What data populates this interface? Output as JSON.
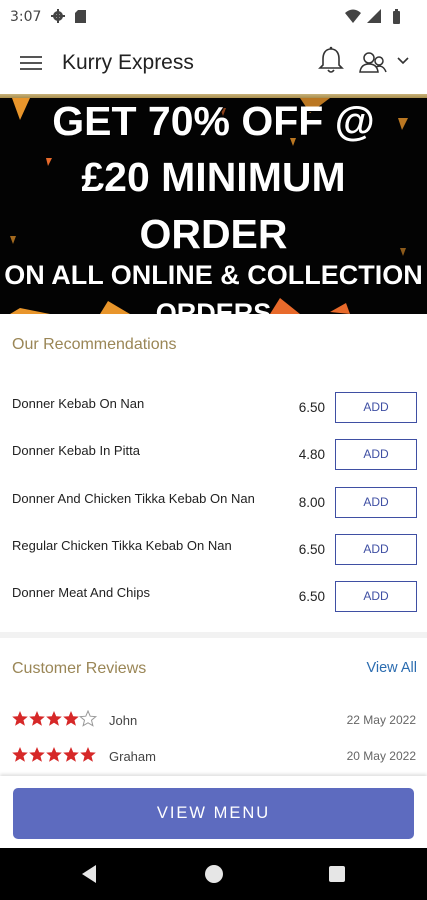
{
  "status_bar": {
    "time": "3:07"
  },
  "app_bar": {
    "title": "Kurry Express"
  },
  "banner": {
    "line1": "GET 70% OFF @",
    "line2": "£20 MINIMUM",
    "line3": "ORDER",
    "line4": "ON ALL ONLINE & COLLECTION",
    "line5": "ORDERS"
  },
  "recommendations": {
    "title": "Our Recommendations",
    "add_label": "ADD",
    "items": [
      {
        "name": "Donner Kebab On Nan",
        "price": "6.50"
      },
      {
        "name": "Donner Kebab In Pitta",
        "price": "4.80"
      },
      {
        "name": "Donner And Chicken Tikka Kebab On Nan",
        "price": "8.00"
      },
      {
        "name": "Regular Chicken Tikka Kebab On Nan",
        "price": "6.50"
      },
      {
        "name": "Donner Meat And Chips",
        "price": "6.50"
      }
    ]
  },
  "reviews": {
    "title": "Customer Reviews",
    "view_all": "View All",
    "star_color": "#d62828",
    "items": [
      {
        "name": "John",
        "rating": 4,
        "date": "22 May 2022"
      },
      {
        "name": "Graham",
        "rating": 5,
        "date": "20 May 2022"
      }
    ]
  },
  "footer": {
    "view_menu": "VIEW MENU",
    "button_color": "#5d6bbf"
  },
  "icons": {
    "menu": "hamburger-menu-icon",
    "bell": "bell-icon",
    "user": "user-account-icon",
    "chevron": "chevron-down-icon",
    "back": "nav-back-icon",
    "home": "nav-home-icon",
    "recent": "nav-recent-apps-icon"
  }
}
